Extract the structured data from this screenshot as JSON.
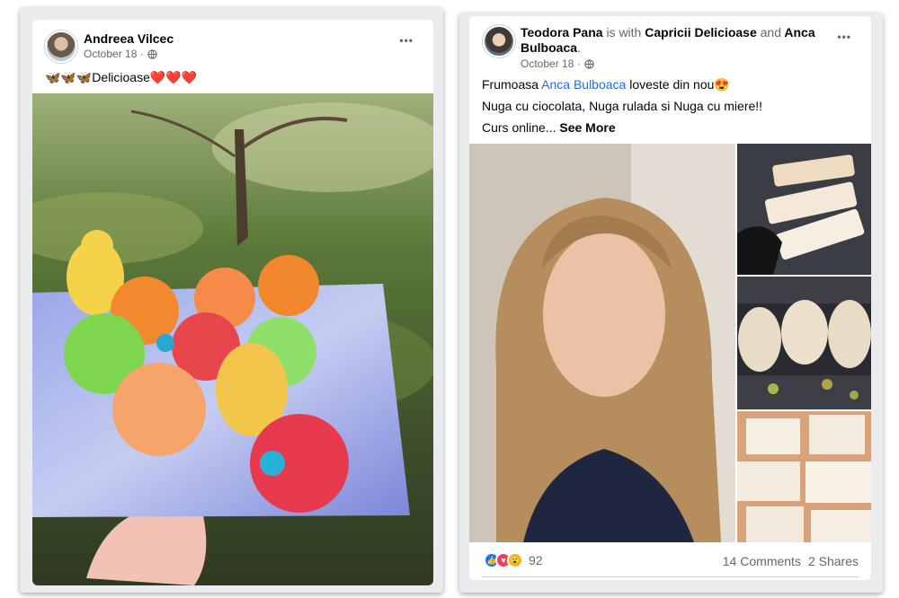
{
  "post_left": {
    "author": "Andreea Vilcec",
    "date": "October 18 ·",
    "caption": "🦋🦋🦋Delicioase❤️❤️❤️",
    "more_label": "•••",
    "avatar_icon": "user-avatar",
    "privacy_icon": "globe-icon"
  },
  "post_right": {
    "author": "Teodora Pana",
    "with_text": "is with",
    "tag1": "Capricii Delicioase",
    "and_text": "and",
    "tag2_line1": "Anca",
    "tag2_line2": "Bulboaca",
    "period": ".",
    "date": "October 18 ·",
    "more_label": "•••",
    "line1_a": "Frumoasa ",
    "line1_mention": "Anca Bulboaca",
    "line1_b": " loveste din nou😍",
    "line2": "Nuga cu ciocolata, Nuga rulada si Nuga cu miere!!",
    "line3_a": "Curs online... ",
    "line3_more": "See More",
    "reaction_count": "92",
    "comments": "14 Comments",
    "shares": "2 Shares",
    "reaction_icons": [
      "like-icon",
      "love-icon",
      "wow-icon"
    ]
  },
  "colors": {
    "frame": "#e9ebee",
    "mention": "#216fdb",
    "like": "#1877f2",
    "love": "#f33e58",
    "wow": "#f7b125"
  }
}
